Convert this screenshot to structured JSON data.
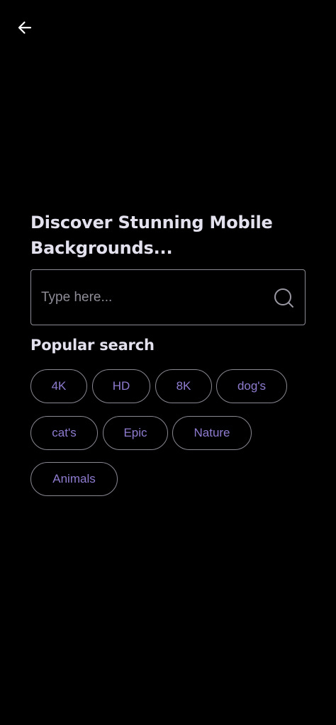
{
  "header": {
    "back_icon": "arrow-left-icon"
  },
  "hero": {
    "line1": "Discover Stunning Mobile",
    "line2": "Backgrounds..."
  },
  "search": {
    "placeholder": "Type here...",
    "value": "",
    "icon": "search-icon"
  },
  "popular": {
    "title": "Popular search",
    "chips": [
      "4K",
      "HD",
      "8K",
      "dog's",
      "cat's",
      "Epic",
      "Nature",
      "Animals"
    ]
  },
  "colors": {
    "background": "#000000",
    "heading": "#e4e1ee",
    "chip_text": "#8f7cd1",
    "border": "#8a8792"
  }
}
